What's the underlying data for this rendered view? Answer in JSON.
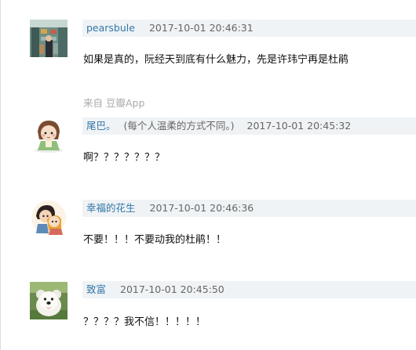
{
  "comments": [
    {
      "avatar_icon": "avatar-supermarket-photo",
      "author": "pearsbule",
      "signature": "",
      "time": "2017-10-01 20:46:31",
      "content": "如果是真的，阮经天到底有什么魅力，先是许玮宁再是杜鹃",
      "source": "来自 豆瓣App"
    },
    {
      "avatar_icon": "avatar-cartoon-girl",
      "author": "尾巴。",
      "signature": "(每个人温柔的方式不同。)",
      "time": "2017-10-01 20:45:32",
      "content": "啊？？？？？？？",
      "source": ""
    },
    {
      "avatar_icon": "avatar-cartoon-couple",
      "author": "幸福的花生",
      "signature": "",
      "time": "2017-10-01 20:46:36",
      "content": "不要！！！不要动我的杜鹃！！",
      "source": ""
    },
    {
      "avatar_icon": "avatar-white-dog",
      "author": "致富",
      "signature": "",
      "time": "2017-10-01 20:45:50",
      "content": "？？？？我不信！！！！！",
      "source": ""
    }
  ],
  "colors": {
    "author_link": "#3377aa",
    "meta_background": "#f0f3f5",
    "muted": "#aaaaaa"
  }
}
